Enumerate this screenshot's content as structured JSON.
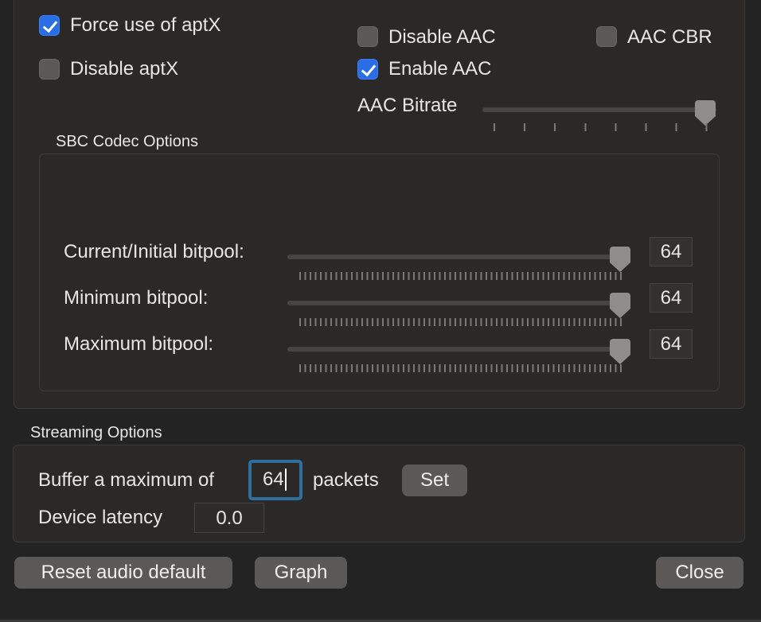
{
  "codec_options": {
    "force_aptx": {
      "label": "Force use of aptX",
      "checked": true
    },
    "disable_aptx": {
      "label": "Disable aptX",
      "checked": false
    },
    "disable_aac": {
      "label": "Disable AAC",
      "checked": false
    },
    "aac_cbr": {
      "label": "AAC CBR",
      "checked": false
    },
    "enable_aac": {
      "label": "Enable AAC",
      "checked": true
    },
    "aac_bitrate": {
      "label": "AAC Bitrate",
      "level_fraction": 1.0
    }
  },
  "sbc": {
    "title": "SBC Codec Options",
    "sliders": [
      {
        "label": "Current/Initial bitpool:",
        "value": "64"
      },
      {
        "label": "Minimum bitpool:",
        "value": "64"
      },
      {
        "label": "Maximum bitpool:",
        "value": "64"
      }
    ]
  },
  "streaming": {
    "title": "Streaming Options",
    "buffer_prefix": "Buffer a maximum of",
    "buffer_value": "64",
    "buffer_suffix": "packets",
    "set_label": "Set",
    "latency_label": "Device latency",
    "latency_value": "0.0"
  },
  "footer": {
    "reset_label": "Reset audio default",
    "graph_label": "Graph",
    "close_label": "Close"
  },
  "colors": {
    "accent": "#2a6ee6",
    "focus_ring": "#2f6fa0"
  }
}
